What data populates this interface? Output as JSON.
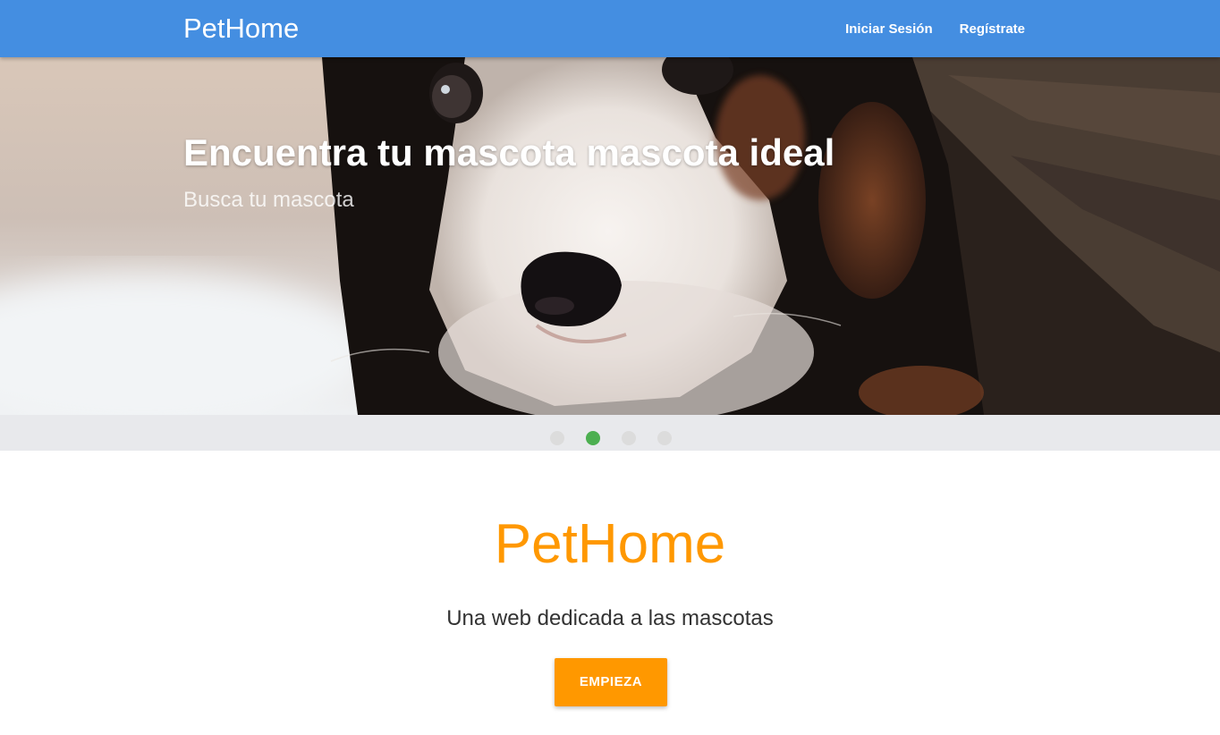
{
  "navbar": {
    "brand": "PetHome",
    "links": [
      {
        "label": "Iniciar Sesión"
      },
      {
        "label": "Regístrate"
      }
    ],
    "background_color": "#448ee1"
  },
  "hero": {
    "title": "Encuentra tu mascota mascota ideal",
    "subtitle": "Busca tu mascota",
    "image": "puppy-photo"
  },
  "carousel": {
    "slide_count": 4,
    "active_index": 1,
    "active_color": "#4caf50"
  },
  "about": {
    "title": "PetHome",
    "description": "Una web dedicada a las mascotas",
    "cta_label": "EMPIEZA",
    "accent_color": "#ff9800"
  }
}
